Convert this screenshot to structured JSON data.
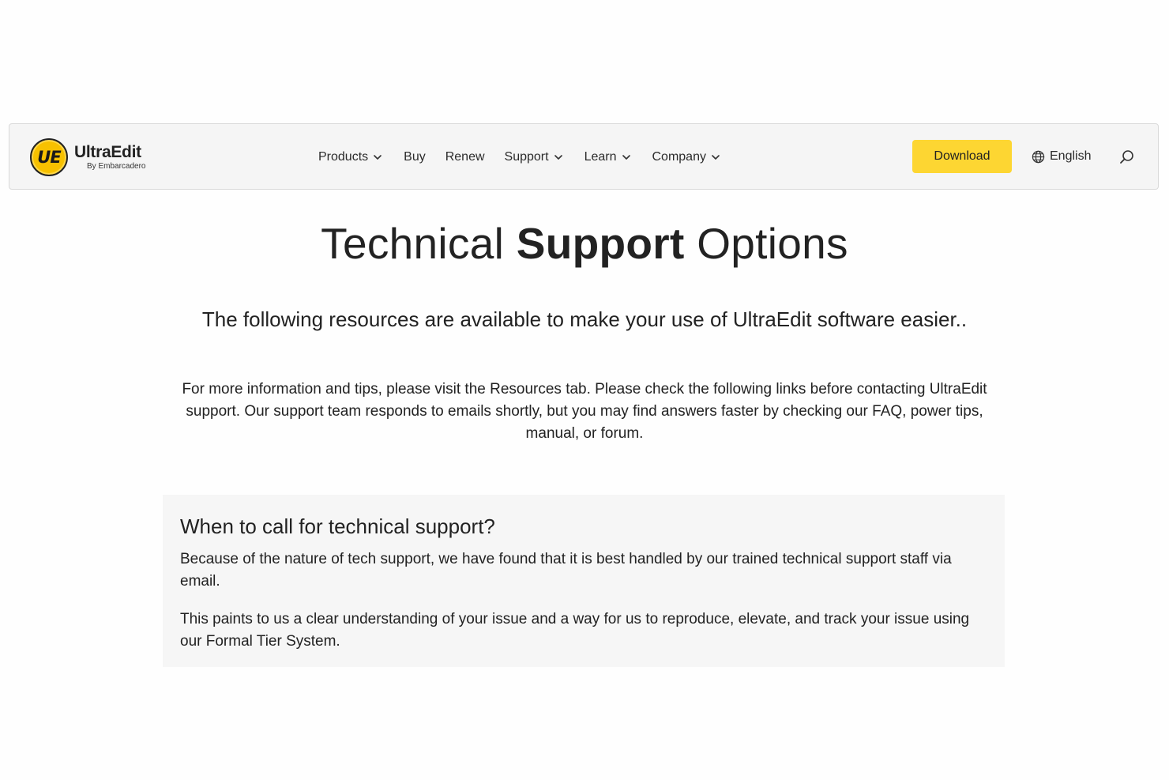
{
  "header": {
    "logo": {
      "badge_text": "UE",
      "name": "UltraEdit",
      "byline": "By Embarcadero"
    },
    "nav": [
      {
        "label": "Products",
        "has_dropdown": true
      },
      {
        "label": "Buy",
        "has_dropdown": false
      },
      {
        "label": "Renew",
        "has_dropdown": false
      },
      {
        "label": "Support",
        "has_dropdown": true
      },
      {
        "label": "Learn",
        "has_dropdown": true
      },
      {
        "label": "Company",
        "has_dropdown": true
      }
    ],
    "download_label": "Download",
    "language_label": "English",
    "icons": [
      "globe-icon",
      "search-icon",
      "chevron-down-icon"
    ]
  },
  "main": {
    "title_part1": "Technical ",
    "title_bold": "Support",
    "title_part2": " Options",
    "subtitle": "The following resources are available to make your use of UltraEdit software easier..",
    "intro": "For more information and tips, please visit the Resources tab. Please check the following links before contacting UltraEdit support. Our support team responds to emails shortly, but you may find answers faster by checking our FAQ, power tips, manual, or forum.",
    "card": {
      "heading": "When to call for technical support?",
      "paragraph1": "Because of the nature of tech support, we have found that it is best handled by our trained technical support staff via email.",
      "paragraph2": "This paints to us a clear understanding of your issue and a way for us to reproduce, elevate, and track your issue using our Formal Tier System."
    }
  },
  "colors": {
    "brand_yellow": "#fdd632",
    "navbar_bg": "#f5f5f5",
    "card_bg": "#f6f6f6",
    "text": "#222222"
  }
}
